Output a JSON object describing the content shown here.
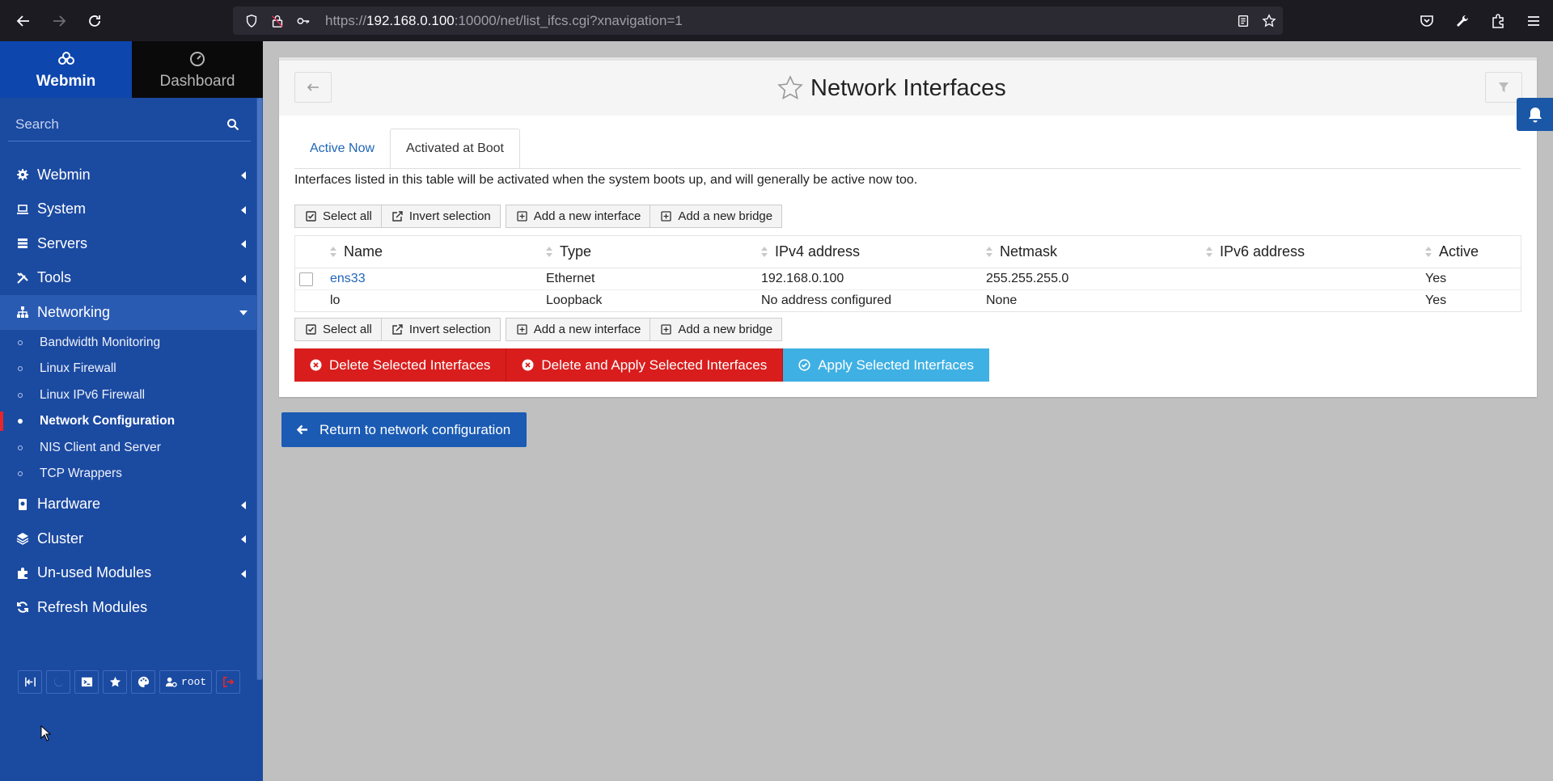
{
  "browser": {
    "url_prefix": "https://",
    "url_host": "192.168.0.100",
    "url_rest": ":10000/net/list_ifcs.cgi?xnavigation=1"
  },
  "sidebar": {
    "tabs": [
      {
        "label": "Webmin",
        "icon": "webmin-logo-icon"
      },
      {
        "label": "Dashboard",
        "icon": "dashboard-gauge-icon"
      }
    ],
    "search_placeholder": "Search",
    "menu": [
      {
        "label": "Webmin",
        "icon": "gear-icon"
      },
      {
        "label": "System",
        "icon": "laptop-icon"
      },
      {
        "label": "Servers",
        "icon": "server-icon"
      },
      {
        "label": "Tools",
        "icon": "tools-icon"
      },
      {
        "label": "Networking",
        "icon": "network-icon"
      }
    ],
    "sub_items": [
      {
        "label": "Bandwidth Monitoring"
      },
      {
        "label": "Linux Firewall"
      },
      {
        "label": "Linux IPv6 Firewall"
      },
      {
        "label": "Network Configuration"
      },
      {
        "label": "NIS Client and Server"
      },
      {
        "label": "TCP Wrappers"
      }
    ],
    "menu_after": [
      {
        "label": "Hardware",
        "icon": "hdd-icon"
      },
      {
        "label": "Cluster",
        "icon": "layers-icon"
      },
      {
        "label": "Un-used Modules",
        "icon": "puzzle-icon"
      },
      {
        "label": "Refresh Modules",
        "icon": "refresh-icon"
      }
    ],
    "user": "root"
  },
  "page": {
    "title": "Network Interfaces",
    "tabs": [
      "Active Now",
      "Activated at Boot"
    ],
    "description": "Interfaces listed in this table will be activated when the system boots up, and will generally be active now too.",
    "buttons": {
      "select_all": "Select all",
      "invert_selection": "Invert selection",
      "add_interface": "Add a new interface",
      "add_bridge": "Add a new bridge"
    },
    "table": {
      "headers": [
        "Name",
        "Type",
        "IPv4 address",
        "Netmask",
        "IPv6 address",
        "Active"
      ],
      "rows": [
        {
          "name": "ens33",
          "type": "Ethernet",
          "ipv4": "192.168.0.100",
          "netmask": "255.255.255.0",
          "ipv6": "",
          "active": "Yes"
        },
        {
          "name": "lo",
          "type": "Loopback",
          "ipv4": "No address configured",
          "netmask": "None",
          "ipv6": "",
          "active": "Yes"
        }
      ]
    },
    "actions": {
      "delete": "Delete Selected Interfaces",
      "delete_apply": "Delete and Apply Selected Interfaces",
      "apply": "Apply Selected Interfaces"
    },
    "return_label": "Return to network configuration"
  },
  "colors": {
    "sidebar_bg": "#1b4aa1",
    "danger": "#d91d1d",
    "info": "#3fb0e3",
    "primary": "#1b5bb4",
    "link": "#2166b7"
  }
}
